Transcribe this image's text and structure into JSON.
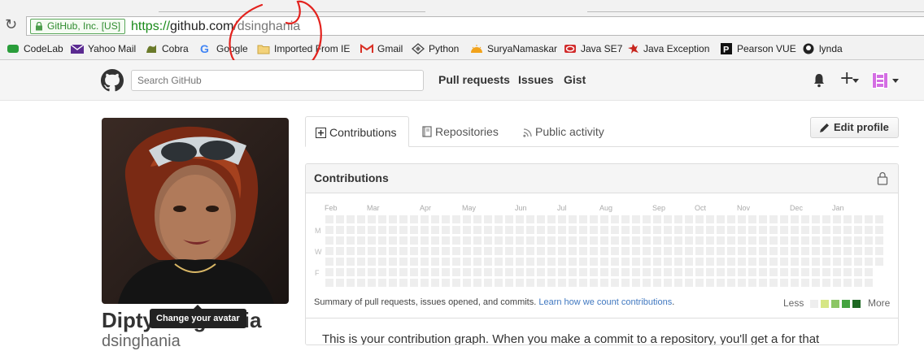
{
  "browser": {
    "ev_label": "GitHub, Inc. [US]",
    "url_scheme": "https://",
    "url_host": "github.com",
    "url_path": "/dsinghania",
    "bookmarks": [
      {
        "label": "CodeLab",
        "icon": "codelab-icon"
      },
      {
        "label": "Yahoo Mail",
        "icon": "yahoo-mail-icon"
      },
      {
        "label": "Cobra",
        "icon": "cobra-icon"
      },
      {
        "label": "Google",
        "icon": "google-icon"
      },
      {
        "label": "Imported From IE",
        "icon": "folder-icon"
      },
      {
        "label": "Gmail",
        "icon": "gmail-icon"
      },
      {
        "label": "Python",
        "icon": "python-icon"
      },
      {
        "label": "SuryaNamaskar",
        "icon": "sunrise-icon"
      },
      {
        "label": "Java SE7",
        "icon": "oracle-icon"
      },
      {
        "label": "Java Exception",
        "icon": "bug-icon"
      },
      {
        "label": "Pearson VUE",
        "icon": "pearson-icon"
      },
      {
        "label": "lynda",
        "icon": "lynda-icon"
      }
    ]
  },
  "header": {
    "search_placeholder": "Search GitHub",
    "nav": [
      "Pull requests",
      "Issues",
      "Gist"
    ]
  },
  "profile": {
    "full_name": "Dipty Singhania",
    "username": "dsinghania",
    "avatar_tooltip": "Change your avatar"
  },
  "tabs": [
    {
      "label": "Contributions",
      "icon": "plus-square-icon",
      "selected": true
    },
    {
      "label": "Repositories",
      "icon": "book-icon",
      "selected": false
    },
    {
      "label": "Public activity",
      "icon": "rss-icon",
      "selected": false
    }
  ],
  "edit_profile_label": "Edit profile",
  "contributions": {
    "title": "Contributions",
    "months": [
      "Feb",
      "Mar",
      "Apr",
      "May",
      "Jun",
      "Jul",
      "Aug",
      "Sep",
      "Oct",
      "Nov",
      "Dec",
      "Jan"
    ],
    "day_labels": [
      "M",
      "W",
      "F"
    ],
    "summary_text": "Summary of pull requests, issues opened, and commits.",
    "summary_link": "Learn how we count contributions",
    "legend_less": "Less",
    "legend_more": "More",
    "legend_colors": [
      "#eeeeee",
      "#d6e685",
      "#8cc665",
      "#44a340",
      "#1e6823"
    ],
    "info_text_visible": "This is your contribution graph. When you make a commit to a repository, you'll get a  for that"
  }
}
